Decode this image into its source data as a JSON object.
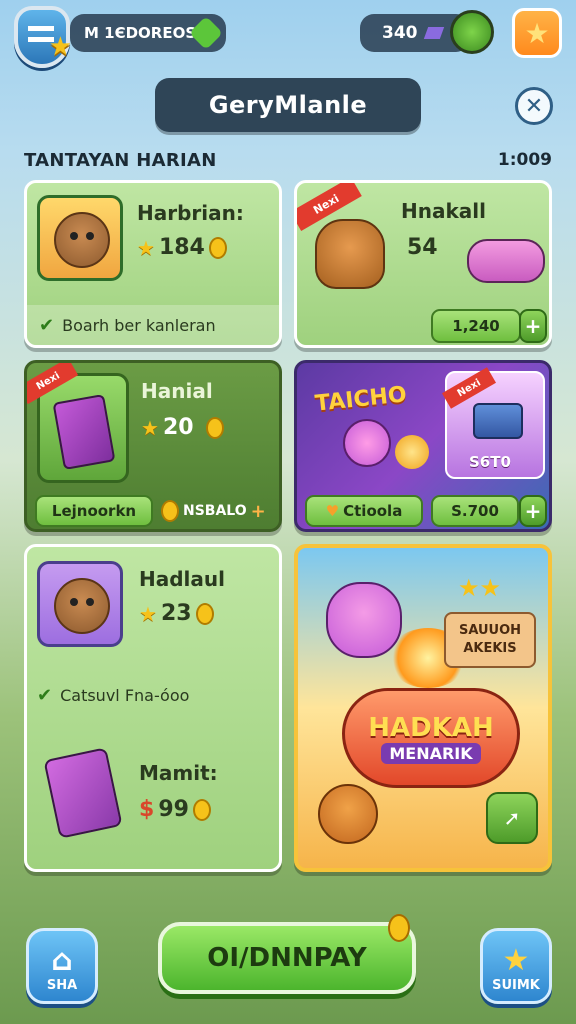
{
  "top_bar": {
    "player_name": "M 1ЄDOREOS",
    "currency_value": "340"
  },
  "title": "GeryMlanle",
  "section": {
    "header": "TANTAYAN HARIAN",
    "timer": "1:009"
  },
  "cards": {
    "c1": {
      "title": "Harbrian:",
      "reward": "184",
      "description": "Boarh ber kanleran"
    },
    "c2": {
      "ribbon": "Nexi",
      "title": "Hnakall",
      "reward": "54",
      "price": "1,240"
    },
    "c3": {
      "ribbon": "Nexi",
      "title": "Hanial",
      "reward": "20",
      "button": "Lejnoorkn",
      "button2": "NSBALO"
    },
    "c4": {
      "banner": "TAICHO",
      "ribbon": "Nexi",
      "price_tag": "S6T0",
      "button": "Ctioola",
      "price": "S.700"
    },
    "c5": {
      "title": "Hadlaul",
      "reward": "23",
      "description": "Catsuvl Fna-óoo",
      "title2": "Mamit:",
      "reward2": "99"
    },
    "promo": {
      "sign": "SAUUOH AKEKIS",
      "heading": "HADKAH",
      "subheading": "MENARIK"
    }
  },
  "bottom": {
    "left_label": "SHA",
    "play_label": "OI/DNNPAY",
    "right_label": "SUIMK"
  },
  "colors": {
    "primary_green": "#6fbf3f",
    "dark_panel": "#2f4557",
    "accent_blue": "#2e86cf",
    "gold": "#f6c21a"
  }
}
